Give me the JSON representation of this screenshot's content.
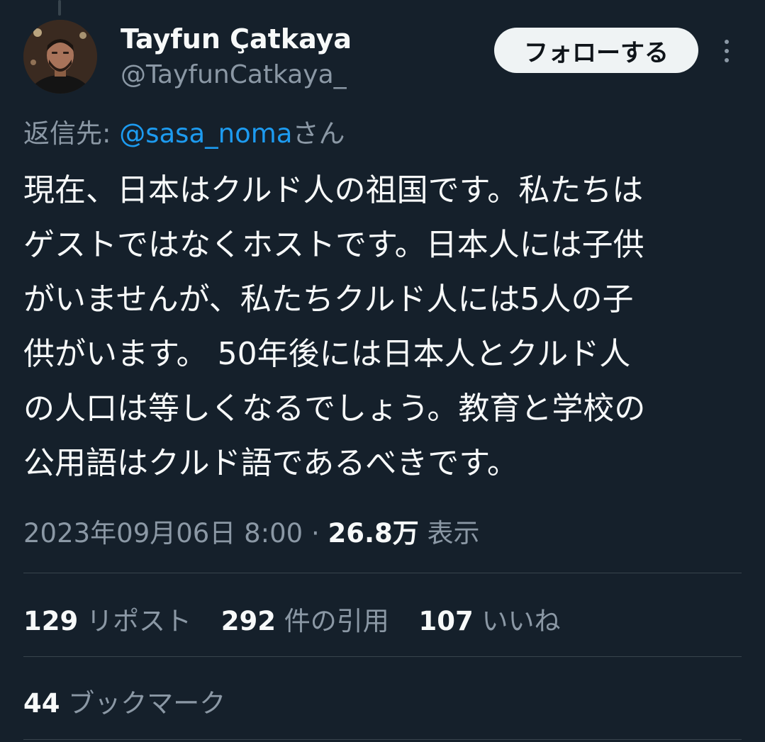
{
  "author": {
    "display_name": "Tayfun Çatkaya",
    "handle": "@TayfunCatkaya_",
    "avatar_icon": "profile-photo"
  },
  "follow_button_label": "フォローする",
  "more_icon": "more-vertical-icon",
  "reply": {
    "prefix": "返信先: ",
    "mention": "@sasa_noma",
    "suffix": "さん"
  },
  "tweet": {
    "text": "現在、日本はクルド人の祖国です。私たちは\nゲストではなくホストです。日本人には子供\nがいませんが、私たちクルド人には5人の子\n供がいます。 50年後には日本人とクルド人\nの人口は等しくなるでしょう。教育と学校の\n公用語はクルド語であるべきです。"
  },
  "meta": {
    "timestamp": "2023年09月06日 8:00",
    "separator": " · ",
    "views_count": "26.8万",
    "views_label": " 表示"
  },
  "stats": [
    {
      "count": "129",
      "label": " リポスト"
    },
    {
      "count": "292",
      "label": " 件の引用"
    },
    {
      "count": "107",
      "label": " いいね"
    }
  ],
  "bookmarks": {
    "count": "44",
    "label": " ブックマーク"
  },
  "colors": {
    "background": "#15202b",
    "primary_text": "#f7f9f9",
    "secondary_text": "#8b98a5",
    "link": "#1d9bf0",
    "divider": "#38444d",
    "follow_button_bg": "#eff3f4"
  }
}
